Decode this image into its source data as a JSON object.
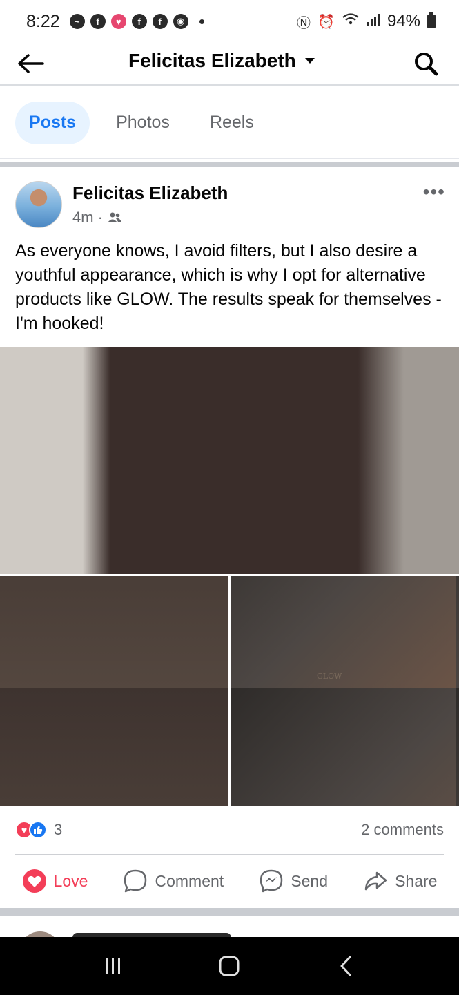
{
  "status_bar": {
    "time": "8:22",
    "battery": "94%"
  },
  "header": {
    "title": "Felicitas Elizabeth"
  },
  "tabs": [
    {
      "label": "Posts",
      "active": true
    },
    {
      "label": "Photos",
      "active": false
    },
    {
      "label": "Reels",
      "active": false
    }
  ],
  "post": {
    "author": "Felicitas Elizabeth",
    "time": "4m",
    "audience_icon": "friends-icon",
    "text": "As everyone knows, I avoid filters, but I also desire a youthful appearance, which is why I opt for alternative products like GLOW. The results speak for themselves - I'm hooked!",
    "photo_label": "GLOW",
    "reactions": {
      "count": "3",
      "types": [
        "love",
        "like"
      ]
    },
    "comments": "2 comments",
    "actions": {
      "love": "Love",
      "comment": "Comment",
      "send": "Send",
      "share": "Share"
    }
  },
  "colors": {
    "brand_blue": "#1877f2",
    "love_red": "#f33e58",
    "secondary_text": "#65676b",
    "tab_active_bg": "#e7f3ff"
  }
}
